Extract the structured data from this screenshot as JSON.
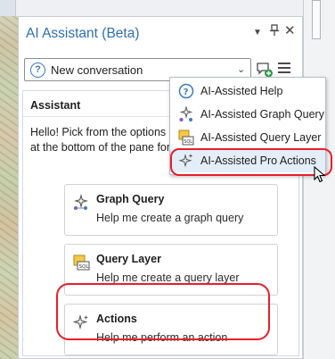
{
  "pane": {
    "title": "AI Assistant (Beta)",
    "conversation_select": {
      "value": "New conversation"
    }
  },
  "assistant": {
    "heading": "Assistant",
    "greeting_line1": "Hello! Pick from the options b",
    "greeting_line2": "at the bottom of the pane for"
  },
  "cards": [
    {
      "title": "Graph Query",
      "description": "Help me create a graph query",
      "icon": "graph-query-sparkle-icon"
    },
    {
      "title": "Query Layer",
      "description": "Help me create a query layer",
      "icon": "sql-query-layer-icon"
    },
    {
      "title": "Actions",
      "description": "Help me perform an action",
      "icon": "sparkle-icon"
    }
  ],
  "menu": {
    "items": [
      {
        "label": "AI-Assisted Help",
        "icon": "help-question-icon"
      },
      {
        "label": "AI-Assisted Graph Query",
        "icon": "graph-query-sparkle-icon"
      },
      {
        "label": "AI-Assisted Query Layer",
        "icon": "sql-query-layer-icon"
      },
      {
        "label": "AI-Assisted Pro Actions",
        "icon": "sparkle-icon"
      }
    ],
    "active_index": 3
  },
  "colors": {
    "title_blue": "#2d6fb3",
    "annotation_red": "#e5202c",
    "menu_hover": "#e4eef8"
  }
}
